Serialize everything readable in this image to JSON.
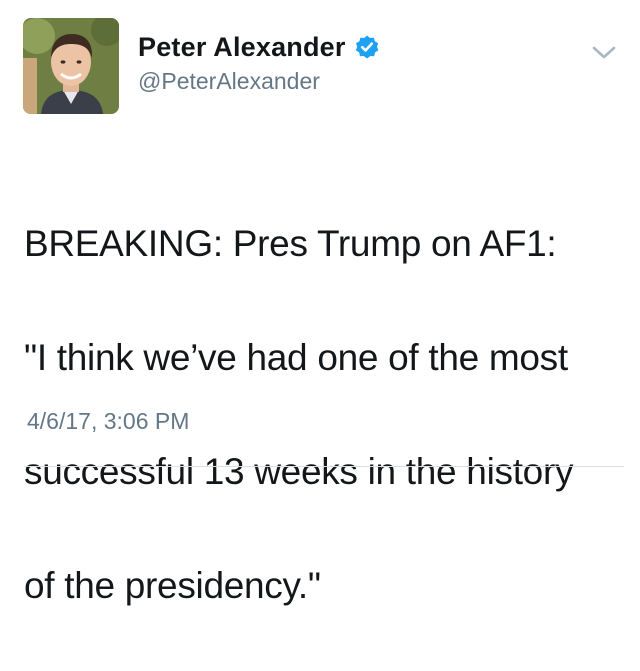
{
  "user": {
    "name": "Peter Alexander",
    "handle": "@PeterAlexander",
    "verified": true
  },
  "icons": {
    "verified": "verified-badge-icon",
    "menu": "chevron-down-icon"
  },
  "tweet": {
    "text_lines": [
      "BREAKING: Pres Trump on AF1:",
      "\"I think we’ve had one of the most",
      "successful 13 weeks in the history",
      "of the presidency.\""
    ],
    "timestamp": "4/6/17, 3:06 PM"
  },
  "colors": {
    "verified_blue": "#1da1f2",
    "secondary_text": "#657786",
    "primary_text": "#14171a"
  }
}
